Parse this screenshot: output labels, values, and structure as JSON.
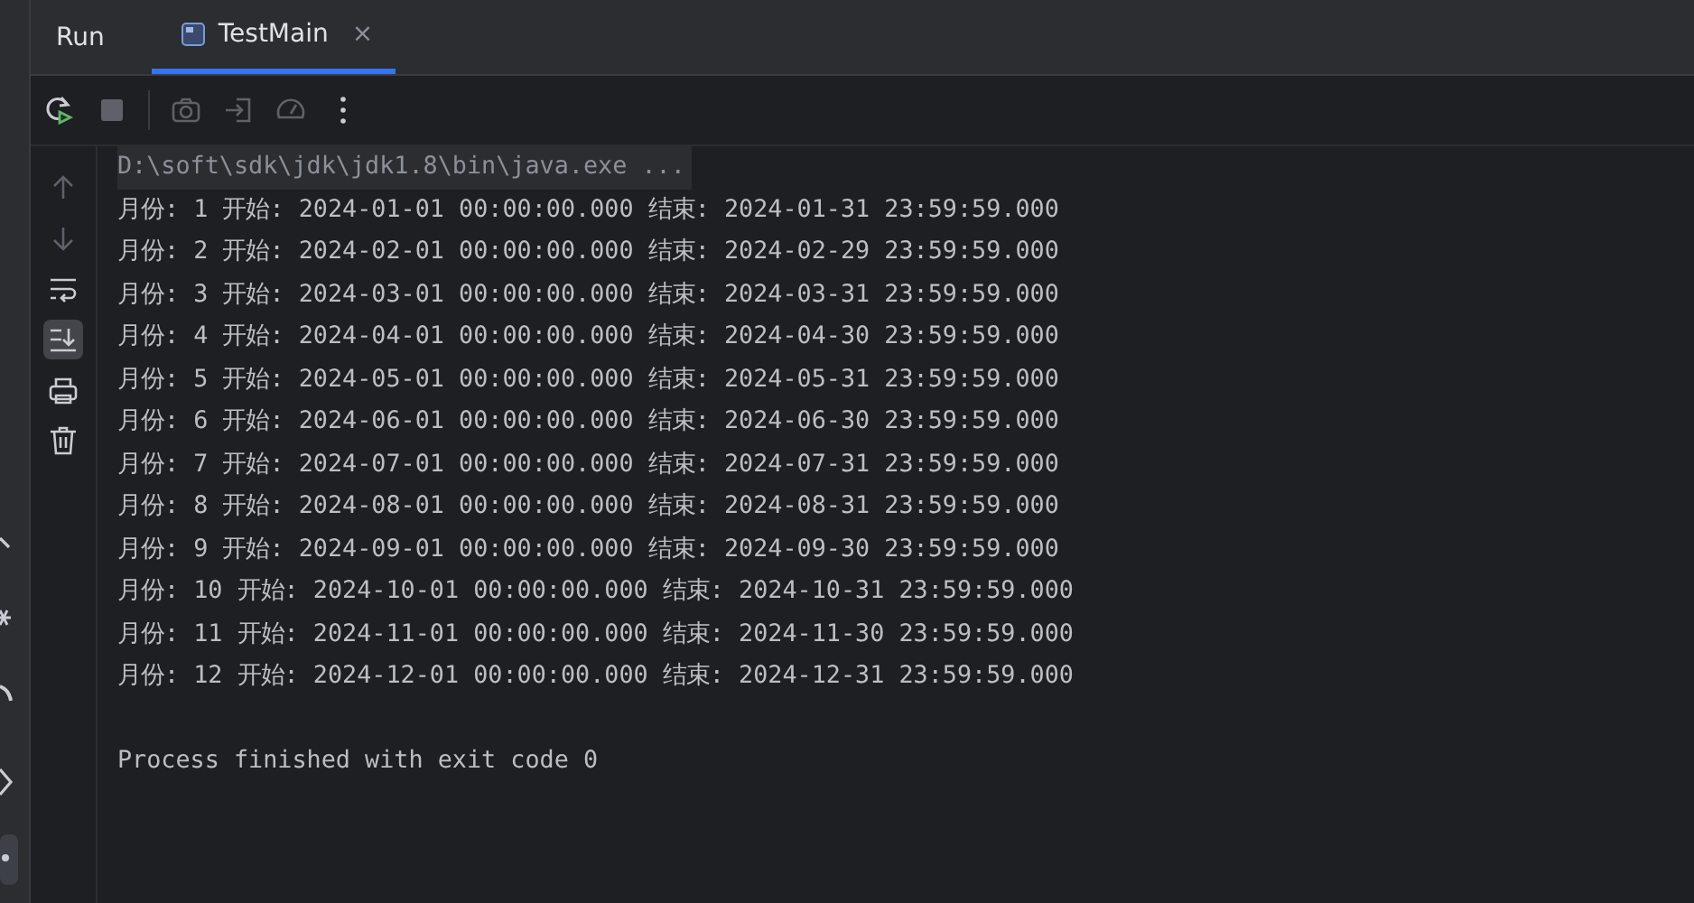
{
  "panel": {
    "title": "Run"
  },
  "tabs": [
    {
      "label": "TestMain",
      "selected": true,
      "closable": "×"
    }
  ],
  "toolbar": [
    {
      "kind": "rerun",
      "disabled": false
    },
    {
      "kind": "stop",
      "disabled": true
    },
    {
      "kind": "camera",
      "disabled": true
    },
    {
      "kind": "attach",
      "disabled": true
    },
    {
      "kind": "gauge",
      "disabled": true
    },
    {
      "kind": "more",
      "disabled": false
    }
  ],
  "gutter": [
    {
      "kind": "up",
      "disabled": true,
      "selected": false
    },
    {
      "kind": "down",
      "disabled": true,
      "selected": false
    },
    {
      "kind": "wrap",
      "disabled": false,
      "selected": false
    },
    {
      "kind": "scroll-end",
      "disabled": false,
      "selected": true
    },
    {
      "kind": "print",
      "disabled": false,
      "selected": false
    },
    {
      "kind": "trash",
      "disabled": false,
      "selected": false
    }
  ],
  "console": [
    {
      "kind": "command",
      "text": "D:\\soft\\sdk\\jdk\\jdk1.8\\bin\\java.exe ..."
    },
    {
      "kind": "output",
      "text": "月份: 1 开始: 2024-01-01 00:00:00.000 结束: 2024-01-31 23:59:59.000"
    },
    {
      "kind": "output",
      "text": "月份: 2 开始: 2024-02-01 00:00:00.000 结束: 2024-02-29 23:59:59.000"
    },
    {
      "kind": "output",
      "text": "月份: 3 开始: 2024-03-01 00:00:00.000 结束: 2024-03-31 23:59:59.000"
    },
    {
      "kind": "output",
      "text": "月份: 4 开始: 2024-04-01 00:00:00.000 结束: 2024-04-30 23:59:59.000"
    },
    {
      "kind": "output",
      "text": "月份: 5 开始: 2024-05-01 00:00:00.000 结束: 2024-05-31 23:59:59.000"
    },
    {
      "kind": "output",
      "text": "月份: 6 开始: 2024-06-01 00:00:00.000 结束: 2024-06-30 23:59:59.000"
    },
    {
      "kind": "output",
      "text": "月份: 7 开始: 2024-07-01 00:00:00.000 结束: 2024-07-31 23:59:59.000"
    },
    {
      "kind": "output",
      "text": "月份: 8 开始: 2024-08-01 00:00:00.000 结束: 2024-08-31 23:59:59.000"
    },
    {
      "kind": "output",
      "text": "月份: 9 开始: 2024-09-01 00:00:00.000 结束: 2024-09-30 23:59:59.000"
    },
    {
      "kind": "output",
      "text": "月份: 10 开始: 2024-10-01 00:00:00.000 结束: 2024-10-31 23:59:59.000"
    },
    {
      "kind": "output",
      "text": "月份: 11 开始: 2024-11-01 00:00:00.000 结束: 2024-11-30 23:59:59.000"
    },
    {
      "kind": "output",
      "text": "月份: 12 开始: 2024-12-01 00:00:00.000 结束: 2024-12-31 23:59:59.000"
    },
    {
      "kind": "exit",
      "text": "Process finished with exit code 0"
    }
  ]
}
